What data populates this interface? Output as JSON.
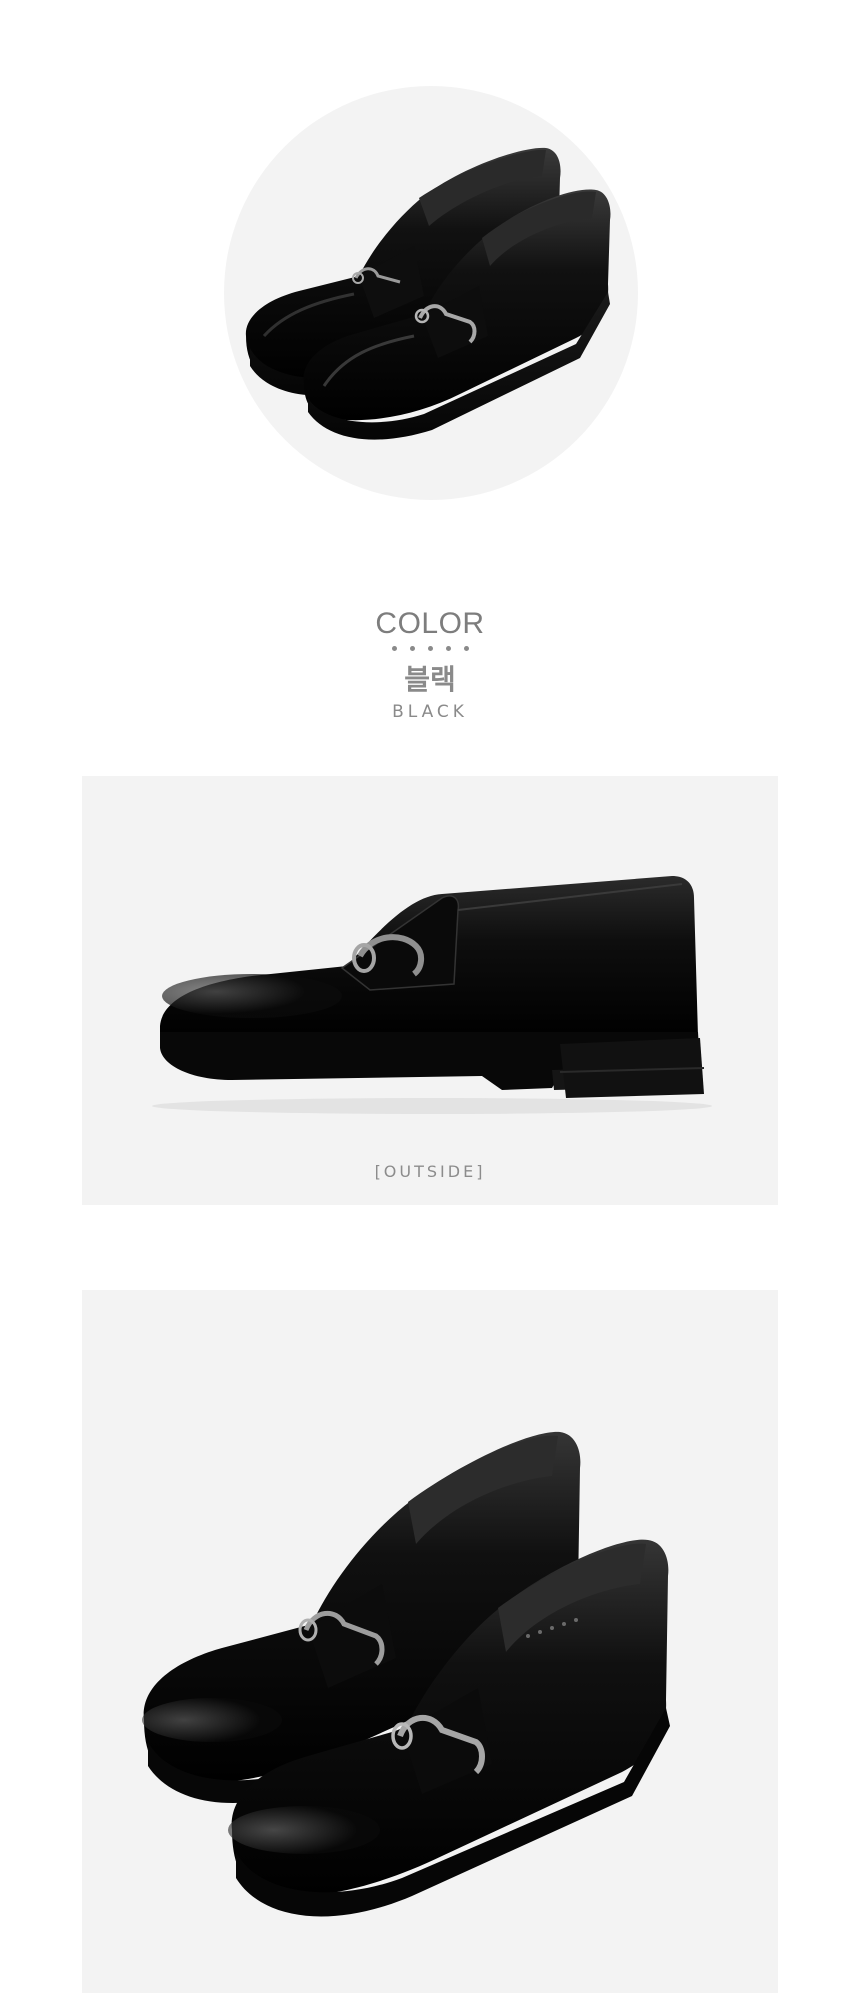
{
  "hero": {
    "image": "black loafer pair with horsebit buckle, three-quarter view",
    "backdrop_color": "#f3f3f3"
  },
  "color_section": {
    "heading": "COLOR",
    "dots_count": 5,
    "name_korean": "블랙",
    "name_english": "BLACK"
  },
  "detail_outside": {
    "caption": "[OUTSIDE]",
    "image": "black loafer side profile",
    "backdrop_color": "#f3f3f3"
  },
  "detail_pair": {
    "image": "black loafer pair close-up",
    "backdrop_color": "#f3f3f3"
  },
  "colors": {
    "page_background": "#ffffff",
    "text_gray": "#8a8a8a",
    "shoe_black": "#0b0b0b"
  }
}
